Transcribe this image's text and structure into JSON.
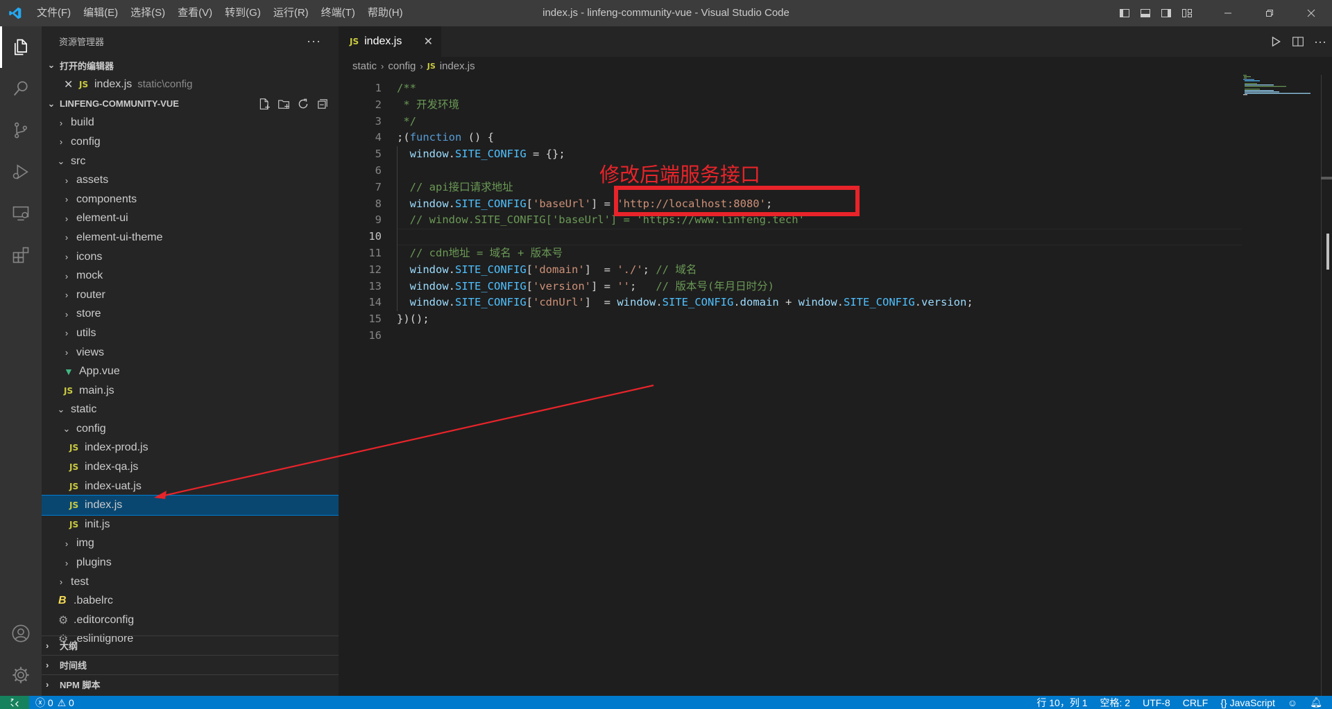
{
  "window": {
    "title": "index.js - linfeng-community-vue - Visual Studio Code",
    "menu": [
      "文件(F)",
      "编辑(E)",
      "选择(S)",
      "查看(V)",
      "转到(G)",
      "运行(R)",
      "终端(T)",
      "帮助(H)"
    ]
  },
  "sidebar": {
    "title": "资源管理器",
    "open_editors": {
      "label": "打开的编辑器",
      "items": [
        {
          "name": "index.js",
          "path": "static\\config"
        }
      ]
    },
    "project": {
      "label": "LINFENG-COMMUNITY-VUE",
      "tree": [
        {
          "label": "build",
          "type": "folder",
          "expanded": false,
          "depth": 0
        },
        {
          "label": "config",
          "type": "folder",
          "expanded": false,
          "depth": 0
        },
        {
          "label": "src",
          "type": "folder",
          "expanded": true,
          "depth": 0
        },
        {
          "label": "assets",
          "type": "folder",
          "expanded": false,
          "depth": 1
        },
        {
          "label": "components",
          "type": "folder",
          "expanded": false,
          "depth": 1
        },
        {
          "label": "element-ui",
          "type": "folder",
          "expanded": false,
          "depth": 1
        },
        {
          "label": "element-ui-theme",
          "type": "folder",
          "expanded": false,
          "depth": 1
        },
        {
          "label": "icons",
          "type": "folder",
          "expanded": false,
          "depth": 1
        },
        {
          "label": "mock",
          "type": "folder",
          "expanded": false,
          "depth": 1
        },
        {
          "label": "router",
          "type": "folder",
          "expanded": false,
          "depth": 1
        },
        {
          "label": "store",
          "type": "folder",
          "expanded": false,
          "depth": 1
        },
        {
          "label": "utils",
          "type": "folder",
          "expanded": false,
          "depth": 1
        },
        {
          "label": "views",
          "type": "folder",
          "expanded": false,
          "depth": 1
        },
        {
          "label": "App.vue",
          "type": "vue",
          "depth": 1
        },
        {
          "label": "main.js",
          "type": "js",
          "depth": 1
        },
        {
          "label": "static",
          "type": "folder",
          "expanded": true,
          "depth": 0
        },
        {
          "label": "config",
          "type": "folder",
          "expanded": true,
          "depth": 1
        },
        {
          "label": "index-prod.js",
          "type": "js",
          "depth": 2
        },
        {
          "label": "index-qa.js",
          "type": "js",
          "depth": 2
        },
        {
          "label": "index-uat.js",
          "type": "js",
          "depth": 2
        },
        {
          "label": "index.js",
          "type": "js",
          "depth": 2,
          "selected": true
        },
        {
          "label": "init.js",
          "type": "js",
          "depth": 2
        },
        {
          "label": "img",
          "type": "folder",
          "expanded": false,
          "depth": 1
        },
        {
          "label": "plugins",
          "type": "folder",
          "expanded": false,
          "depth": 1
        },
        {
          "label": "test",
          "type": "folder",
          "expanded": false,
          "depth": 0
        },
        {
          "label": ".babelrc",
          "type": "babel",
          "depth": 0
        },
        {
          "label": ".editorconfig",
          "type": "gear",
          "depth": 0
        },
        {
          "label": ".eslintignore",
          "type": "gear",
          "depth": 0
        }
      ]
    },
    "bottom_sections": [
      "大纲",
      "时间线",
      "NPM 脚本"
    ]
  },
  "editor": {
    "tab": {
      "name": "index.js"
    },
    "breadcrumb": [
      "static",
      "config",
      "index.js"
    ],
    "current_line": 10,
    "lines": [
      [
        {
          "t": "/**",
          "c": "cm"
        }
      ],
      [
        {
          "t": " * 开发环境",
          "c": "cm"
        }
      ],
      [
        {
          "t": " */",
          "c": "cm"
        }
      ],
      [
        {
          "t": ";(",
          "c": "plain"
        },
        {
          "t": "function",
          "c": "kw"
        },
        {
          "t": " () {",
          "c": "plain"
        }
      ],
      [
        {
          "t": "  window",
          "c": "var"
        },
        {
          "t": ".",
          "c": "plain"
        },
        {
          "t": "SITE_CONFIG",
          "c": "const"
        },
        {
          "t": " = {};",
          "c": "plain"
        }
      ],
      [],
      [
        {
          "t": "  // api接口请求地址",
          "c": "cm"
        }
      ],
      [
        {
          "t": "  window",
          "c": "var"
        },
        {
          "t": ".",
          "c": "plain"
        },
        {
          "t": "SITE_CONFIG",
          "c": "const"
        },
        {
          "t": "[",
          "c": "plain"
        },
        {
          "t": "'baseUrl'",
          "c": "str"
        },
        {
          "t": "] = ",
          "c": "plain"
        },
        {
          "t": "'http://localhost:8080'",
          "c": "str"
        },
        {
          "t": ";",
          "c": "plain"
        }
      ],
      [
        {
          "t": "  // window.SITE_CONFIG['baseUrl'] = 'https://www.linfeng.tech'",
          "c": "cm"
        }
      ],
      [],
      [
        {
          "t": "  // cdn地址 = 域名 + 版本号",
          "c": "cm"
        }
      ],
      [
        {
          "t": "  window",
          "c": "var"
        },
        {
          "t": ".",
          "c": "plain"
        },
        {
          "t": "SITE_CONFIG",
          "c": "const"
        },
        {
          "t": "[",
          "c": "plain"
        },
        {
          "t": "'domain'",
          "c": "str"
        },
        {
          "t": "]  = ",
          "c": "plain"
        },
        {
          "t": "'./'",
          "c": "str"
        },
        {
          "t": "; ",
          "c": "plain"
        },
        {
          "t": "// 域名",
          "c": "cm"
        }
      ],
      [
        {
          "t": "  window",
          "c": "var"
        },
        {
          "t": ".",
          "c": "plain"
        },
        {
          "t": "SITE_CONFIG",
          "c": "const"
        },
        {
          "t": "[",
          "c": "plain"
        },
        {
          "t": "'version'",
          "c": "str"
        },
        {
          "t": "] = ",
          "c": "plain"
        },
        {
          "t": "''",
          "c": "str"
        },
        {
          "t": ";   ",
          "c": "plain"
        },
        {
          "t": "// 版本号(年月日时分)",
          "c": "cm"
        }
      ],
      [
        {
          "t": "  window",
          "c": "var"
        },
        {
          "t": ".",
          "c": "plain"
        },
        {
          "t": "SITE_CONFIG",
          "c": "const"
        },
        {
          "t": "[",
          "c": "plain"
        },
        {
          "t": "'cdnUrl'",
          "c": "str"
        },
        {
          "t": "]  = ",
          "c": "plain"
        },
        {
          "t": "window",
          "c": "var"
        },
        {
          "t": ".",
          "c": "plain"
        },
        {
          "t": "SITE_CONFIG",
          "c": "const"
        },
        {
          "t": ".",
          "c": "plain"
        },
        {
          "t": "domain",
          "c": "var"
        },
        {
          "t": " + ",
          "c": "plain"
        },
        {
          "t": "window",
          "c": "var"
        },
        {
          "t": ".",
          "c": "plain"
        },
        {
          "t": "SITE_CONFIG",
          "c": "const"
        },
        {
          "t": ".",
          "c": "plain"
        },
        {
          "t": "version",
          "c": "var"
        },
        {
          "t": ";",
          "c": "plain"
        }
      ],
      [
        {
          "t": "})();",
          "c": "plain"
        }
      ],
      []
    ],
    "annotation": "修改后端服务接口"
  },
  "statusbar": {
    "errors": "0",
    "warnings": "0",
    "position": "行 10，列 1",
    "spaces": "空格: 2",
    "encoding": "UTF-8",
    "eol": "CRLF",
    "language": "JavaScript"
  },
  "colors": {
    "accent": "#007acc",
    "annotation": "#e8242a",
    "selection": "#094771"
  }
}
